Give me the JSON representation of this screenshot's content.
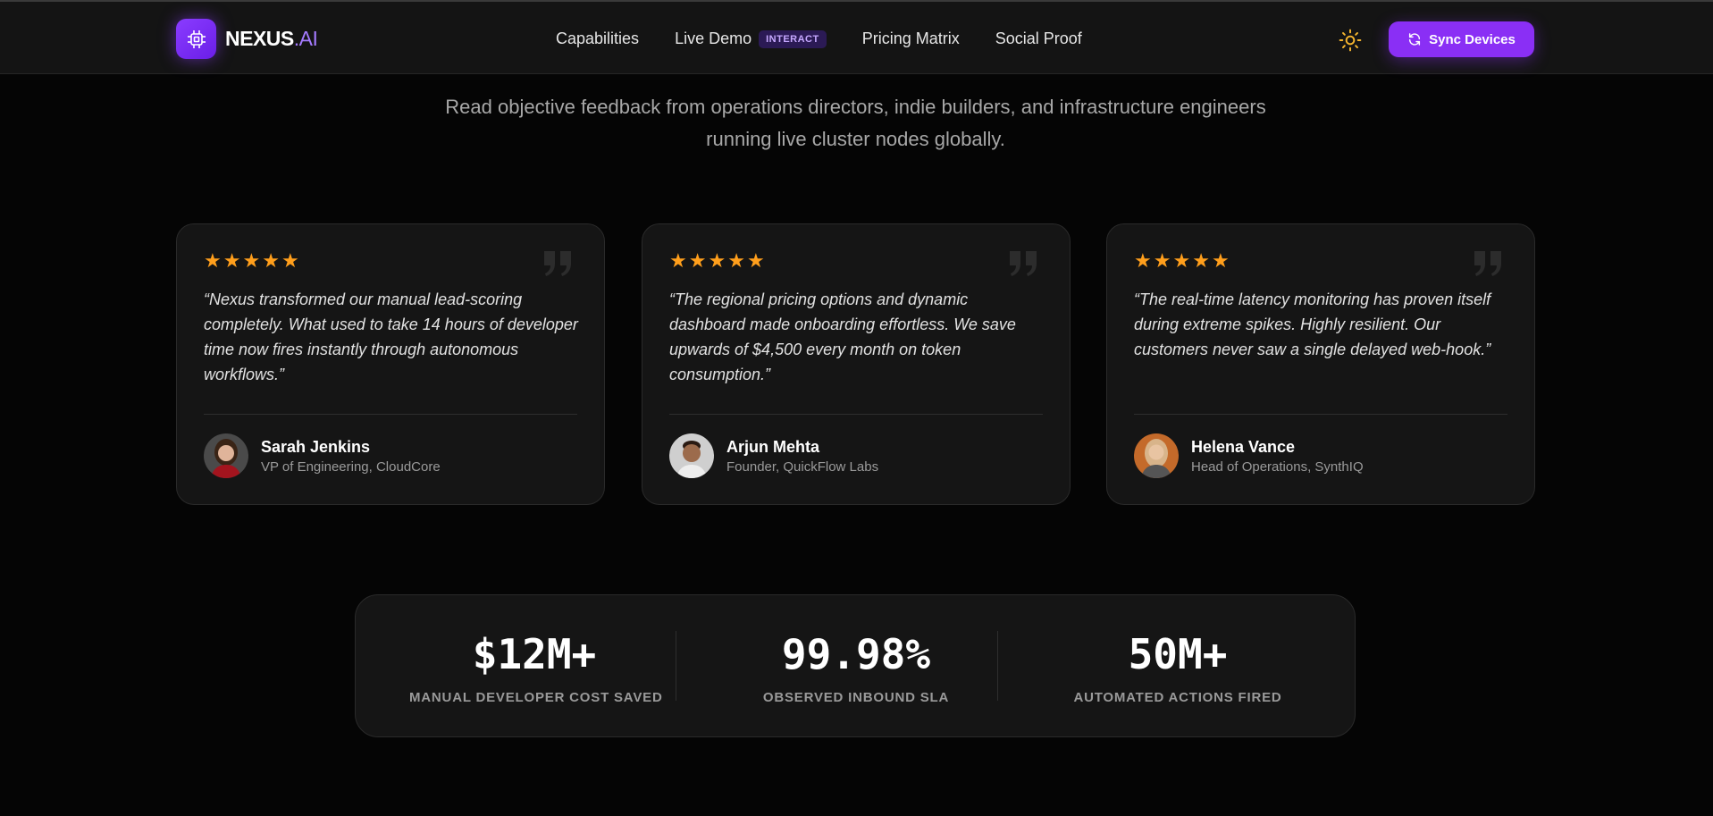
{
  "nav": {
    "brand_main": "NEXUS",
    "brand_accent": ".AI",
    "links": [
      {
        "label": "Capabilities"
      },
      {
        "label": "Live Demo",
        "badge": "INTERACT"
      },
      {
        "label": "Pricing Matrix"
      },
      {
        "label": "Social Proof"
      }
    ],
    "theme_toggle_icon": "sun-icon",
    "sync_button": "Sync Devices"
  },
  "intro": {
    "text": "Read objective feedback from operations directors, indie builders, and infrastructure engineers running live cluster nodes globally."
  },
  "testimonials": [
    {
      "rating": 5,
      "quote": "“Nexus transformed our manual lead-scoring completely. What used to take 14 hours of developer time now fires instantly through autonomous workflows.”",
      "name": "Sarah Jenkins",
      "role": "VP of Engineering, CloudCore"
    },
    {
      "rating": 5,
      "quote": "“The regional pricing options and dynamic dashboard made onboarding effortless. We save upwards of $4,500 every month on token consumption.”",
      "name": "Arjun Mehta",
      "role": "Founder, QuickFlow Labs"
    },
    {
      "rating": 5,
      "quote": "“The real-time latency monitoring has proven itself during extreme spikes. Highly resilient. Our customers never saw a single delayed web-hook.”",
      "name": "Helena Vance",
      "role": "Head of Operations, SynthIQ"
    }
  ],
  "stats": [
    {
      "value": "$12M+",
      "label": "MANUAL DEVELOPER COST SAVED"
    },
    {
      "value": "99.98%",
      "label": "OBSERVED INBOUND SLA"
    },
    {
      "value": "50M+",
      "label": "AUTOMATED ACTIONS FIRED"
    }
  ],
  "colors": {
    "accent": "#8a2ff5",
    "star": "#ff9f1c",
    "background": "#050505",
    "card": "#151515"
  }
}
